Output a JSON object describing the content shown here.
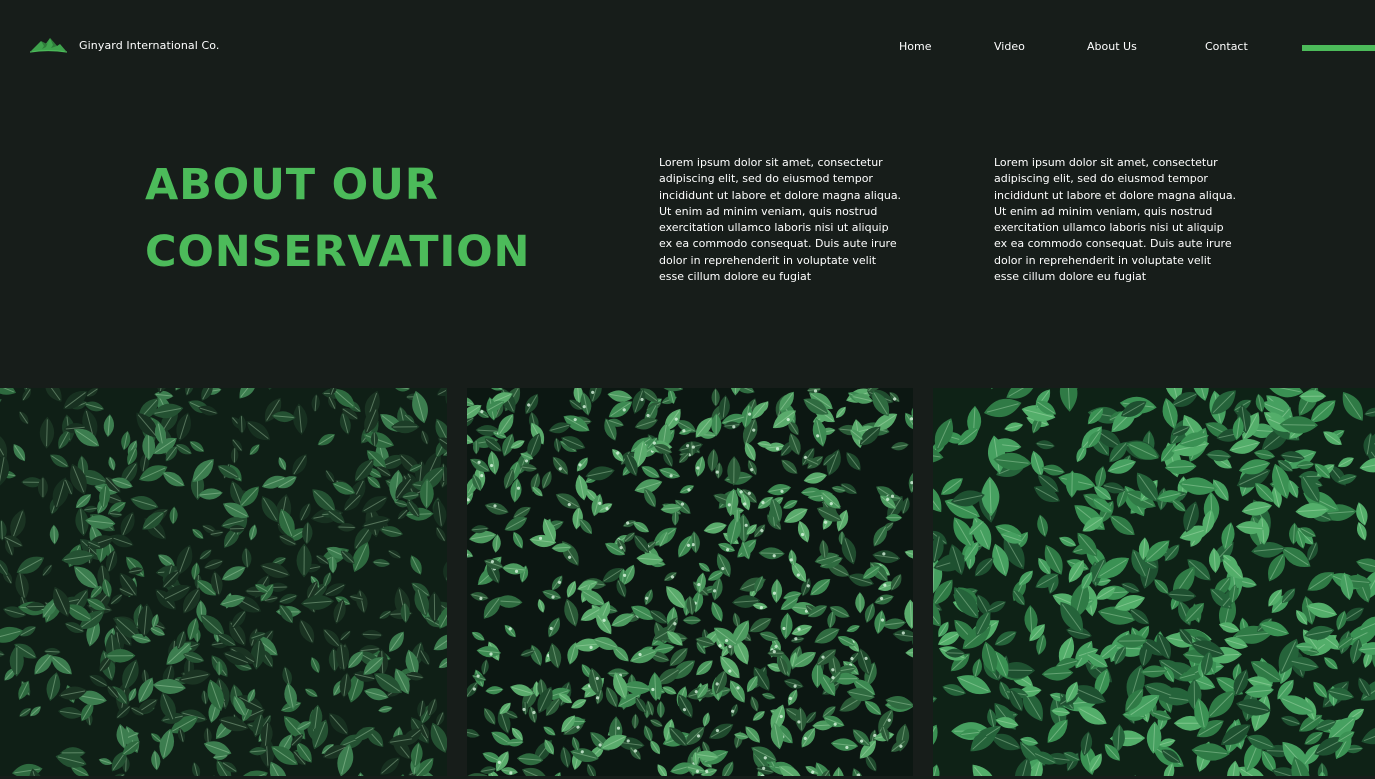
{
  "brand": {
    "name": "Ginyard International Co.",
    "logo_icon": "mountain-logo-icon"
  },
  "nav": {
    "items": [
      {
        "label": "Home"
      },
      {
        "label": "Video"
      },
      {
        "label": "About Us"
      },
      {
        "label": "Contact"
      }
    ]
  },
  "hero": {
    "title_line1": "ABOUT OUR",
    "title_line2": "CONSERVATION",
    "paragraphs": [
      "Lorem ipsum dolor sit amet, consectetur adipiscing elit, sed do eiusmod tempor incididunt ut labore et dolore magna aliqua. Ut enim ad minim veniam, quis nostrud exercitation ullamco laboris nisi ut aliquip ex ea commodo consequat. Duis aute irure dolor in reprehenderit in voluptate velit esse cillum dolore eu fugiat",
      "Lorem ipsum dolor sit amet, consectetur adipiscing elit, sed do eiusmod tempor incididunt ut labore et dolore magna aliqua. Ut enim ad minim veniam, quis nostrud exercitation ullamco laboris nisi ut aliquip ex ea commodo consequat. Duis aute irure dolor in reprehenderit in voluptate velit esse cillum dolore eu fugiat"
    ]
  },
  "gallery": {
    "images": [
      {
        "subject": "dark green leaves foliage"
      },
      {
        "subject": "green leaves with water droplets"
      },
      {
        "subject": "bright green serrated leaves"
      }
    ]
  },
  "colors": {
    "background": "#171d1a",
    "accent": "#4cbb5a",
    "text": "#ffffff"
  }
}
